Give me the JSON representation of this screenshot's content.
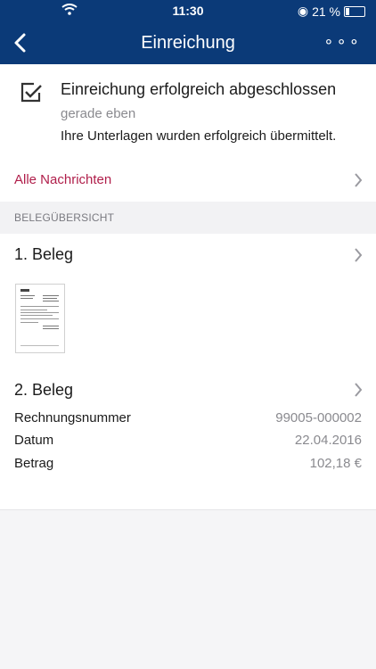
{
  "status_bar": {
    "time": "11:30",
    "battery": "21 %",
    "battery_level": 0.21
  },
  "nav": {
    "title": "Einreichung",
    "back_icon": "chevron-left-icon",
    "more_icon": "ellipsis-icon"
  },
  "message": {
    "title": "Einreichung erfolgreich abgeschlossen",
    "time": "gerade eben",
    "body": "Ihre Unterlagen wurden erfolgreich übermittelt."
  },
  "all_messages_label": "Alle Nachrichten",
  "section_label": "BELEGÜBERSICHT",
  "receipts": [
    {
      "title": "1. Beleg"
    },
    {
      "title": "2. Beleg",
      "details": [
        {
          "label": "Rechnungsnummer",
          "value": "99005-000002"
        },
        {
          "label": "Datum",
          "value": "22.04.2016"
        },
        {
          "label": "Betrag",
          "value": "102,18 €"
        }
      ]
    }
  ],
  "colors": {
    "header": "#0b3a78",
    "link": "#b01e4a"
  }
}
